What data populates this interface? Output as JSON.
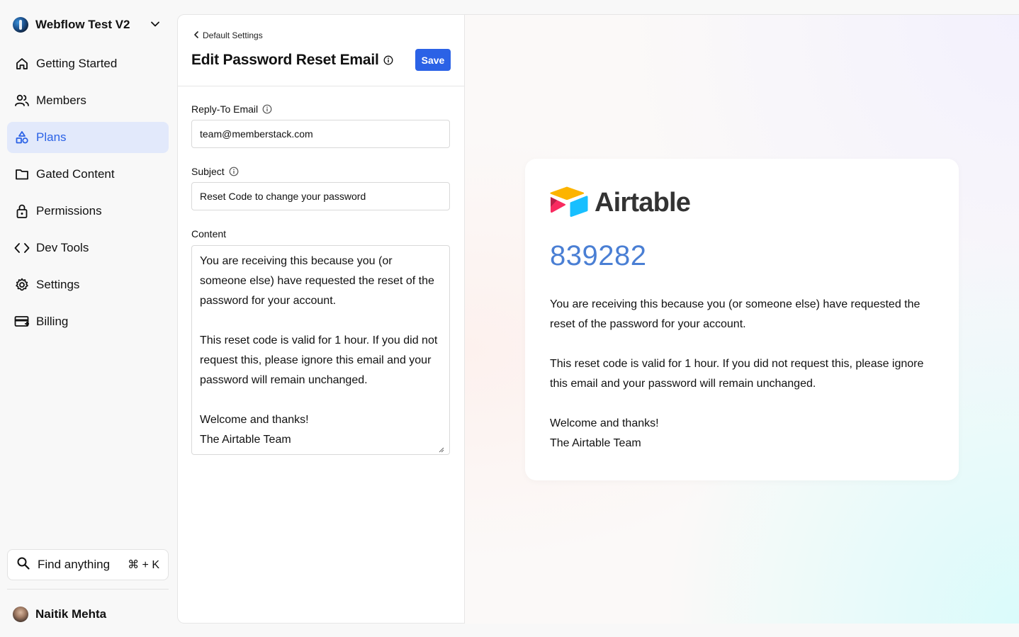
{
  "workspace": {
    "name": "Webflow Test V2"
  },
  "nav": {
    "items": [
      {
        "label": "Getting Started",
        "icon": "home-icon"
      },
      {
        "label": "Members",
        "icon": "users-icon"
      },
      {
        "label": "Plans",
        "icon": "shapes-icon",
        "active": true
      },
      {
        "label": "Gated Content",
        "icon": "folder-icon"
      },
      {
        "label": "Permissions",
        "icon": "lock-icon"
      },
      {
        "label": "Dev Tools",
        "icon": "code-icon"
      },
      {
        "label": "Settings",
        "icon": "gear-icon"
      },
      {
        "label": "Billing",
        "icon": "credit-card-icon"
      }
    ]
  },
  "search": {
    "label": "Find anything",
    "shortcut": "⌘ + K"
  },
  "user": {
    "name": "Naitik Mehta"
  },
  "editor": {
    "back_label": "Default Settings",
    "title": "Edit Password Reset Email",
    "save_label": "Save",
    "reply_to": {
      "label": "Reply-To Email",
      "value": "team@memberstack.com"
    },
    "subject": {
      "label": "Subject",
      "value": "Reset Code to change your password"
    },
    "content": {
      "label": "Content",
      "value": "You are receiving this because you (or someone else) have requested the reset of the password for your account.\n\nThis reset code is valid for 1 hour. If you did not request this, please ignore this email and your password will remain unchanged.\n\nWelcome and thanks!\nThe Airtable Team"
    }
  },
  "preview": {
    "brand": "Airtable",
    "code": "839282",
    "paragraph1": "You are receiving this because you (or someone else) have requested the reset of the password for your account.",
    "paragraph2": "This reset code is valid for 1 hour. If you did not request this, please ignore this email and your password will remain unchanged.",
    "closing_line1": "Welcome and thanks!",
    "closing_line2": "The Airtable Team"
  },
  "colors": {
    "accent": "#2b62e6",
    "active_nav_bg": "#e2e9fb",
    "code_color": "#4a7fd4",
    "airtable_yellow": "#fcb400",
    "airtable_red": "#f82b60",
    "airtable_blue": "#18bfff"
  }
}
